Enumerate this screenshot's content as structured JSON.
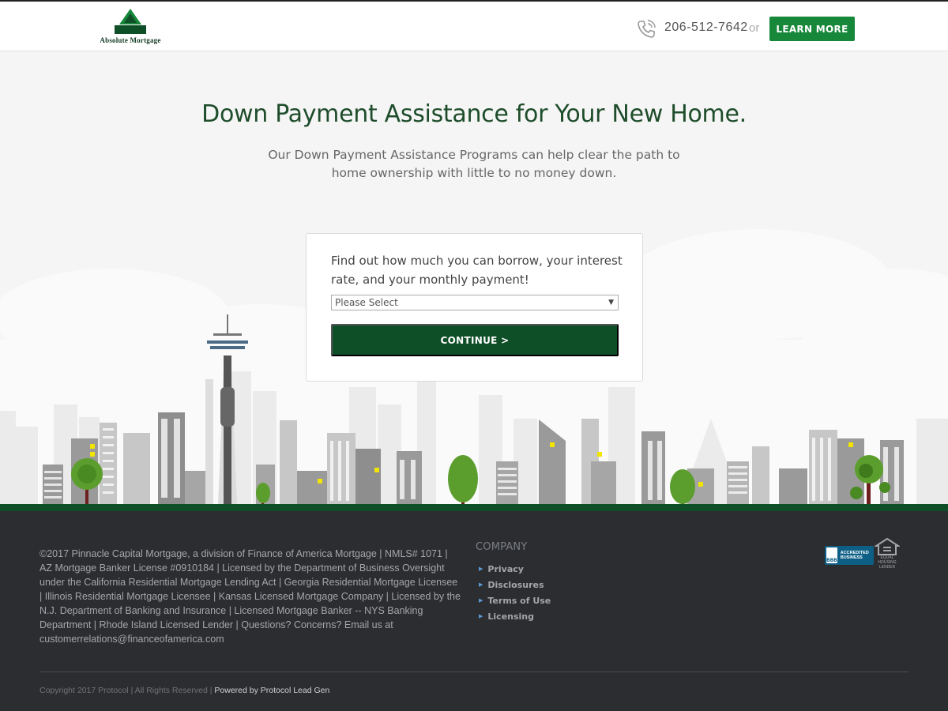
{
  "header": {
    "logo_text": "Absolute Mortgage",
    "phone": "206-512-7642",
    "or": "or",
    "learn_more": "LEARN MORE"
  },
  "hero": {
    "title": "Down Payment Assistance for Your New Home.",
    "subtitle": "Our Down Payment Assistance Programs can help clear the path to home ownership with little to no money down."
  },
  "form": {
    "question": "Find out how much you can borrow, your interest rate, and your monthly payment!",
    "select_value": "Please Select",
    "continue_label": "CONTINUE >"
  },
  "footer": {
    "legal": "©2017 Pinnacle Capital Mortgage, a division of Finance of America Mortgage | NMLS# 1071 | AZ Mortgage Banker License #0910184 | Licensed by the Department of Business Oversight under the California Residential Mortgage Lending Act | Georgia Residential Mortgage Licensee | Illinois Residential Mortgage Licensee | Kansas Licensed Mortgage Company | Licensed by the N.J. Department of Banking and Insurance | Licensed Mortgage Banker -- NYS Banking Department | Rhode Island Licensed Lender | Questions? Concerns? Email us at customerrelations@financeofamerica.com",
    "company_title": "COMPANY",
    "company_links": [
      "Privacy",
      "Disclosures",
      "Terms of Use",
      "Licensing"
    ],
    "bbb_mark": "BBB",
    "bbb_label": "ACCREDITED BUSINESS",
    "eho_label": "EQUAL HOUSING LENDER",
    "copyright": "Copyright 2017 Protocol | All Rights Reserved |",
    "powered_by": "Powered by Protocol Lead Gen"
  },
  "colors": {
    "brand_green": "#0f4f28",
    "button_green": "#17873a",
    "footer_bg": "#2b2d31"
  }
}
